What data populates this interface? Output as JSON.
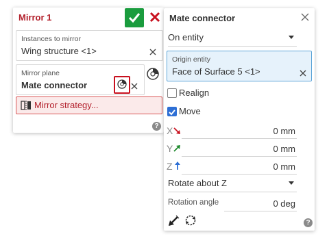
{
  "mirror": {
    "title": "Mirror 1",
    "instances": {
      "label": "Instances to mirror",
      "value": "Wing structure <1>"
    },
    "plane": {
      "label": "Mirror plane",
      "value": "Mate connector"
    },
    "strategy_label": "Mirror strategy...",
    "help": "?"
  },
  "mate_connector": {
    "title": "Mate connector",
    "placement": "On entity",
    "origin": {
      "label": "Origin entity",
      "value": "Face of Surface 5 <1>"
    },
    "realign_label": "Realign",
    "realign_checked": false,
    "move_label": "Move",
    "move_checked": true,
    "x": {
      "letter": "X",
      "value": "0 mm"
    },
    "y": {
      "letter": "Y",
      "value": "0 mm"
    },
    "z": {
      "letter": "Z",
      "value": "0 mm"
    },
    "rotate": "Rotate about Z",
    "angle": {
      "label": "Rotation angle",
      "value": "0 deg"
    },
    "help": "?"
  },
  "colors": {
    "accent_red": "#b3202c",
    "ok_green": "#1a9c3e",
    "selection_blue": "#5fa6d8",
    "checkbox_blue": "#2e6fd5"
  },
  "icons": [
    "checkmark-icon",
    "close-icon",
    "reference-plane-icon",
    "mirror-strategy-icon",
    "help-icon",
    "flip-direction-icon",
    "rotate-icon"
  ]
}
